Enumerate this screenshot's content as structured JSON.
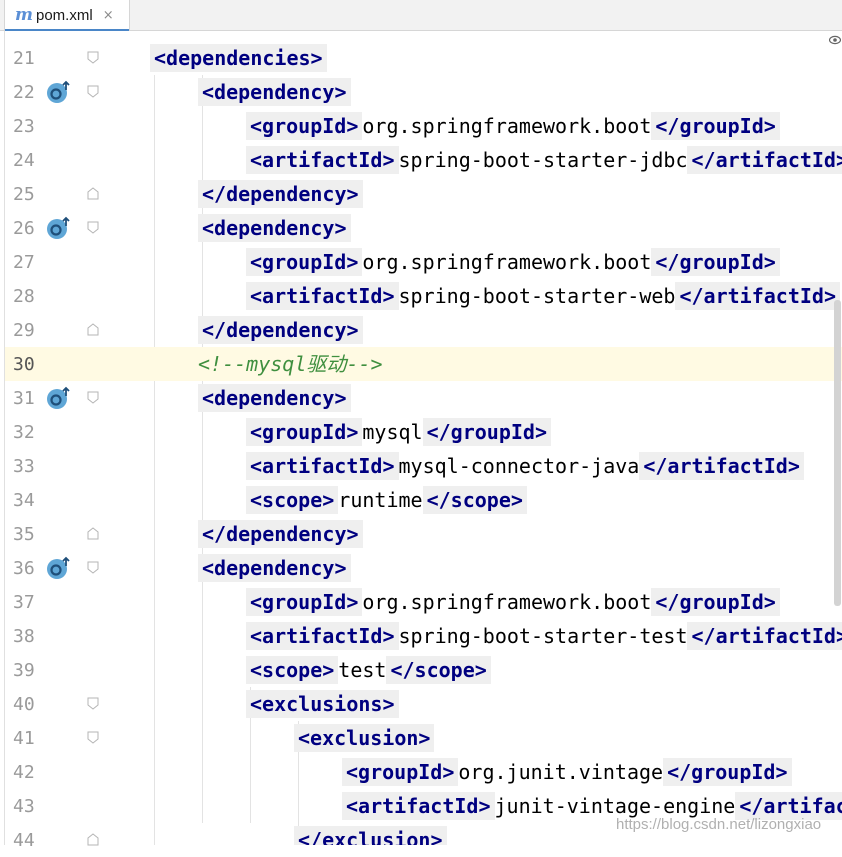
{
  "tab": {
    "icon": "m",
    "title": "pom.xml",
    "close": "×"
  },
  "watermark": "https://blog.csdn.net/lizongxiao",
  "current_line": 30,
  "lines": [
    {
      "num": "21",
      "indent": 0,
      "gutter_icon": null,
      "fold": "start",
      "parts": [
        [
          "tag",
          "<dependencies>"
        ]
      ]
    },
    {
      "num": "22",
      "indent": 1,
      "gutter_icon": "maven-dependency-icon",
      "fold": "start",
      "parts": [
        [
          "tag",
          "<dependency>"
        ]
      ]
    },
    {
      "num": "23",
      "indent": 2,
      "gutter_icon": null,
      "fold": null,
      "parts": [
        [
          "tag",
          "<groupId>"
        ],
        [
          "txt",
          "org.springframework.boot"
        ],
        [
          "tag",
          "</groupId>"
        ]
      ]
    },
    {
      "num": "24",
      "indent": 2,
      "gutter_icon": null,
      "fold": null,
      "parts": [
        [
          "tag",
          "<artifactId>"
        ],
        [
          "txt",
          "spring-boot-starter-jdbc"
        ],
        [
          "tag",
          "</artifactId>"
        ]
      ]
    },
    {
      "num": "25",
      "indent": 1,
      "gutter_icon": null,
      "fold": "end",
      "parts": [
        [
          "tag",
          "</dependency>"
        ]
      ]
    },
    {
      "num": "26",
      "indent": 1,
      "gutter_icon": "maven-dependency-icon",
      "fold": "start",
      "parts": [
        [
          "tag",
          "<dependency>"
        ]
      ]
    },
    {
      "num": "27",
      "indent": 2,
      "gutter_icon": null,
      "fold": null,
      "parts": [
        [
          "tag",
          "<groupId>"
        ],
        [
          "txt",
          "org.springframework.boot"
        ],
        [
          "tag",
          "</groupId>"
        ]
      ]
    },
    {
      "num": "28",
      "indent": 2,
      "gutter_icon": null,
      "fold": null,
      "parts": [
        [
          "tag",
          "<artifactId>"
        ],
        [
          "txt",
          "spring-boot-starter-web"
        ],
        [
          "tag",
          "</artifactId>"
        ]
      ]
    },
    {
      "num": "29",
      "indent": 1,
      "gutter_icon": null,
      "fold": "end",
      "parts": [
        [
          "tag",
          "</dependency>"
        ]
      ]
    },
    {
      "num": "30",
      "indent": 1,
      "gutter_icon": null,
      "fold": null,
      "parts": [
        [
          "comment",
          "<!--mysql驱动-->"
        ]
      ]
    },
    {
      "num": "31",
      "indent": 1,
      "gutter_icon": "maven-dependency-icon",
      "fold": "start",
      "parts": [
        [
          "tag",
          "<dependency>"
        ]
      ]
    },
    {
      "num": "32",
      "indent": 2,
      "gutter_icon": null,
      "fold": null,
      "parts": [
        [
          "tag",
          "<groupId>"
        ],
        [
          "txt",
          "mysql"
        ],
        [
          "tag",
          "</groupId>"
        ]
      ]
    },
    {
      "num": "33",
      "indent": 2,
      "gutter_icon": null,
      "fold": null,
      "parts": [
        [
          "tag",
          "<artifactId>"
        ],
        [
          "txt",
          "mysql-connector-java"
        ],
        [
          "tag",
          "</artifactId>"
        ]
      ]
    },
    {
      "num": "34",
      "indent": 2,
      "gutter_icon": null,
      "fold": null,
      "parts": [
        [
          "tag",
          "<scope>"
        ],
        [
          "txt",
          "runtime"
        ],
        [
          "tag",
          "</scope>"
        ]
      ]
    },
    {
      "num": "35",
      "indent": 1,
      "gutter_icon": null,
      "fold": "end",
      "parts": [
        [
          "tag",
          "</dependency>"
        ]
      ]
    },
    {
      "num": "36",
      "indent": 1,
      "gutter_icon": "maven-dependency-icon",
      "fold": "start",
      "parts": [
        [
          "tag",
          "<dependency>"
        ]
      ]
    },
    {
      "num": "37",
      "indent": 2,
      "gutter_icon": null,
      "fold": null,
      "parts": [
        [
          "tag",
          "<groupId>"
        ],
        [
          "txt",
          "org.springframework.boot"
        ],
        [
          "tag",
          "</groupId>"
        ]
      ]
    },
    {
      "num": "38",
      "indent": 2,
      "gutter_icon": null,
      "fold": null,
      "parts": [
        [
          "tag",
          "<artifactId>"
        ],
        [
          "txt",
          "spring-boot-starter-test"
        ],
        [
          "tag",
          "</artifactId>"
        ]
      ]
    },
    {
      "num": "39",
      "indent": 2,
      "gutter_icon": null,
      "fold": null,
      "parts": [
        [
          "tag",
          "<scope>"
        ],
        [
          "txt",
          "test"
        ],
        [
          "tag",
          "</scope>"
        ]
      ]
    },
    {
      "num": "40",
      "indent": 2,
      "gutter_icon": null,
      "fold": "start",
      "parts": [
        [
          "tag",
          "<exclusions>"
        ]
      ]
    },
    {
      "num": "41",
      "indent": 3,
      "gutter_icon": null,
      "fold": "start",
      "parts": [
        [
          "tag",
          "<exclusion>"
        ]
      ]
    },
    {
      "num": "42",
      "indent": 4,
      "gutter_icon": null,
      "fold": null,
      "parts": [
        [
          "tag",
          "<groupId>"
        ],
        [
          "txt",
          "org.junit.vintage"
        ],
        [
          "tag",
          "</groupId>"
        ]
      ]
    },
    {
      "num": "43",
      "indent": 4,
      "gutter_icon": null,
      "fold": null,
      "parts": [
        [
          "tag",
          "<artifactId>"
        ],
        [
          "txt",
          "junit-vintage-engine"
        ],
        [
          "tag",
          "</artifact"
        ]
      ]
    },
    {
      "num": "44",
      "indent": 3,
      "gutter_icon": null,
      "fold": "end",
      "parts": [
        [
          "tag",
          "</exclusion>"
        ]
      ]
    }
  ],
  "colors": {
    "tag": "#000080",
    "tag_bg": "#efefef",
    "comment": "#3f8f3f",
    "current_line_bg": "#fffae3",
    "tab_underline": "#4a86c8"
  }
}
